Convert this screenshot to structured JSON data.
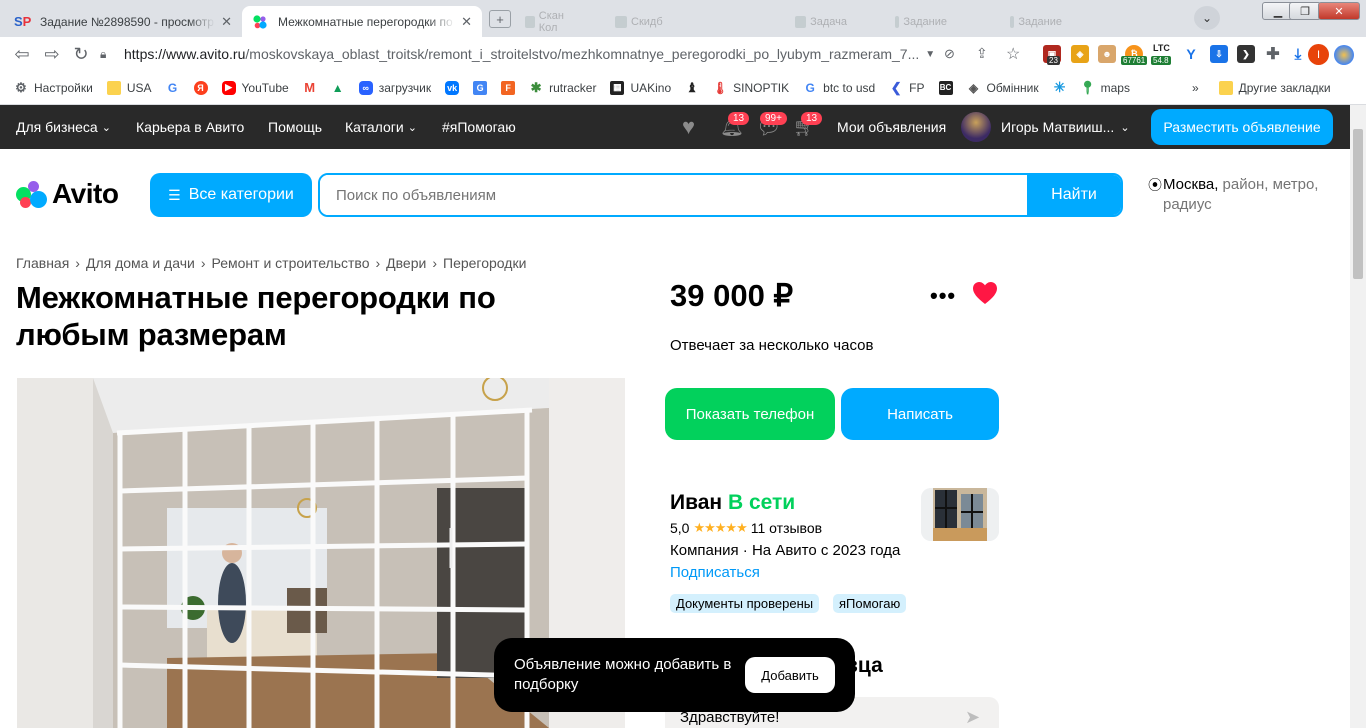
{
  "browser": {
    "tabs": [
      {
        "favicon": "SP",
        "title": "Задание №2898590 - просмотр з"
      },
      {
        "favicon": "avito-icon",
        "title": "Межкомнатные перегородки по"
      }
    ],
    "new_tab_symbol": "+",
    "background_tabs": [
      "Скан Кол",
      "Скидб",
      "Задача",
      "Задание",
      "Задание"
    ],
    "url_host": "https://www.avito.ru",
    "url_path": "/moskovskaya_oblast_troitsk/remont_i_stroitelstvo/mezhkomnatnye_peregorodki_po_lyubym_razmeram_7...",
    "ext_badges": {
      "badge1": "23",
      "badge2": "67761",
      "ltc_label": "LTC",
      "ltc_value": "54.8",
      "profile": "I"
    },
    "bookmarks": [
      "Настройки",
      "USA",
      "",
      "",
      "YouTube",
      "",
      "",
      "загрузчик",
      "",
      "",
      "",
      "rutracker",
      "UAKino",
      "",
      "SINOPTIK",
      "btc to usd",
      "FP",
      "",
      "Обмінник",
      "",
      "maps"
    ],
    "bookmarks_more": "»",
    "other_bookmarks": "Другие закладки"
  },
  "avito_nav": {
    "business": "Для бизнеса",
    "career": "Карьера в Авито",
    "help": "Помощь",
    "catalogs": "Каталоги",
    "ihelp": "#яПомогаю",
    "notif_badge": "13",
    "msg_badge": "99+",
    "cart_badge": "13",
    "my_ads": "Мои объявления",
    "user_name": "Игорь Матвииш...",
    "post_button": "Разместить объявление"
  },
  "header": {
    "logo": "Avito",
    "categories_button": "Все категории",
    "search_placeholder": "Поиск по объявлениям",
    "search_value": "",
    "find_button": "Найти",
    "location_city": "Москва,",
    "location_rest": " район, метро, радиус"
  },
  "breadcrumbs": [
    "Главная",
    "Для дома и дачи",
    "Ремонт и строительство",
    "Двери",
    "Перегородки"
  ],
  "breadcrumb_sep": "›",
  "listing": {
    "title": "Межкомнатные перегородки по любым размерам",
    "price": "39 000 ₽",
    "response_time": "Отвечает за несколько часов",
    "more_symbol": "•••",
    "show_phone": "Показать телефон",
    "write": "Написать"
  },
  "seller": {
    "name": "Иван",
    "online": "В сети",
    "rating": "5,0",
    "stars": "★★★★★",
    "reviews": "11 отзывов",
    "company": "Компания · На Авито с 2023 года",
    "subscribe": "Подписаться",
    "tags": [
      "Документы проверены",
      "яПомогаю"
    ]
  },
  "ask_seller": {
    "heading_visible": "вца",
    "message": "Здравствуйте!"
  },
  "toast": {
    "text": "Объявление можно добавить в подборку",
    "button": "Добавить"
  },
  "colors": {
    "avito_blue": "#00aaff",
    "avito_green": "#02d15c",
    "heart_red": "#ff4053",
    "nav_dark": "#292929"
  }
}
